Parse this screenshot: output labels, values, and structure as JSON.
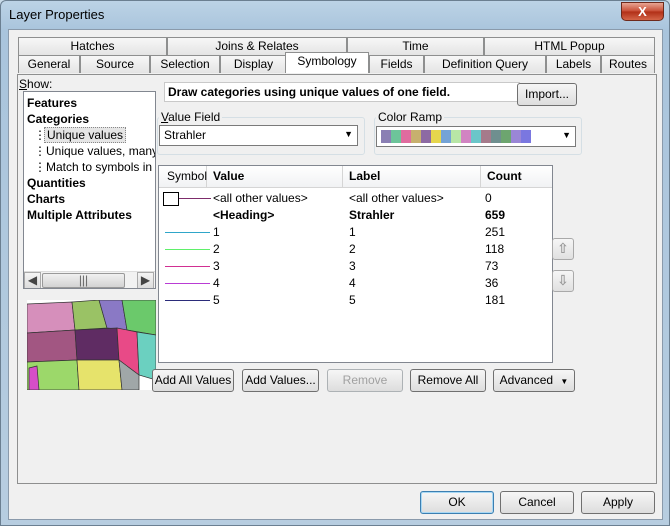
{
  "window": {
    "title": "Layer Properties",
    "close_glyph": "X"
  },
  "tabs_row1": [
    "Hatches",
    "Joins & Relates",
    "Time",
    "HTML Popup"
  ],
  "tabs_row2": [
    "General",
    "Source",
    "Selection",
    "Display",
    "Symbology",
    "Fields",
    "Definition Query",
    "Labels",
    "Routes"
  ],
  "active_tab": "Symbology",
  "show": {
    "label": "Show:",
    "tree": [
      {
        "label": "Features",
        "bold": true,
        "indent": 0
      },
      {
        "label": "Categories",
        "bold": true,
        "indent": 0
      },
      {
        "label": "Unique values",
        "bold": false,
        "indent": 1,
        "selected": true
      },
      {
        "label": "Unique values, many",
        "bold": false,
        "indent": 1
      },
      {
        "label": "Match to symbols in a",
        "bold": false,
        "indent": 1
      },
      {
        "label": "Quantities",
        "bold": true,
        "indent": 0
      },
      {
        "label": "Charts",
        "bold": true,
        "indent": 0
      },
      {
        "label": "Multiple Attributes",
        "bold": true,
        "indent": 0
      }
    ]
  },
  "description": "Draw categories using unique values of one field.",
  "import_button": "Import...",
  "value_field": {
    "label": "Value Field",
    "value": "Strahler"
  },
  "color_ramp": {
    "label": "Color Ramp",
    "colors": [
      "#8a7fb4",
      "#6dc49a",
      "#e06c9f",
      "#c7b06e",
      "#8d6aa3",
      "#e6d64d",
      "#74a3d6",
      "#b8e6a6",
      "#d184c2",
      "#6bc6c9",
      "#a57a8b",
      "#6f8f8f",
      "#6da56f",
      "#9a86d6",
      "#7a77e0"
    ]
  },
  "table": {
    "headers": {
      "symbol": "Symbol",
      "value": "Value",
      "label": "Label",
      "count": "Count"
    },
    "rows": [
      {
        "symbol": "box",
        "color": "#7d2c6b",
        "value": "<all other values>",
        "label": "<all other values>",
        "count": "0",
        "bold": false
      },
      {
        "symbol": "none",
        "color": "",
        "value": "<Heading>",
        "label": "Strahler",
        "count": "659",
        "bold": true
      },
      {
        "symbol": "line",
        "color": "#2fa6c9",
        "value": "1",
        "label": "1",
        "count": "251",
        "bold": false
      },
      {
        "symbol": "line",
        "color": "#5ff06a",
        "value": "2",
        "label": "2",
        "count": "118",
        "bold": false
      },
      {
        "symbol": "line",
        "color": "#d12f92",
        "value": "3",
        "label": "3",
        "count": "73",
        "bold": false
      },
      {
        "symbol": "line",
        "color": "#b93cd4",
        "value": "4",
        "label": "4",
        "count": "36",
        "bold": false
      },
      {
        "symbol": "line",
        "color": "#2b2c7a",
        "value": "5",
        "label": "5",
        "count": "181",
        "bold": false
      }
    ]
  },
  "buttons": {
    "add_all": "Add All Values",
    "add_values": "Add Values...",
    "remove": "Remove",
    "remove_all": "Remove All",
    "advanced": "Advanced",
    "ok": "OK",
    "cancel": "Cancel",
    "apply": "Apply"
  }
}
